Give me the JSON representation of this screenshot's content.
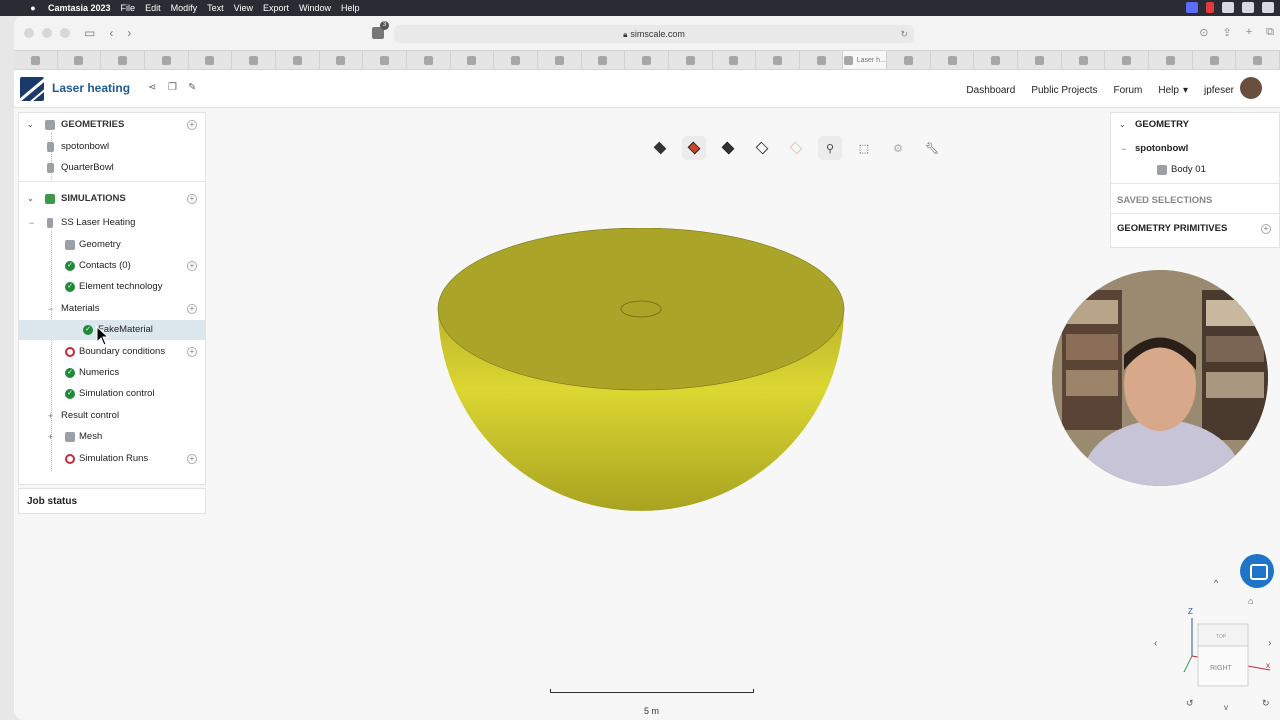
{
  "menubar": {
    "app_name": "Camtasia 2023",
    "items": [
      "File",
      "Edit",
      "Modify",
      "Text",
      "View",
      "Export",
      "Window",
      "Help"
    ]
  },
  "browser": {
    "url": "simscale.com",
    "tab_count_badge": "3",
    "active_tab_label": "Laser h..."
  },
  "header": {
    "project_title": "Laser heating",
    "nav": [
      "Dashboard",
      "Public Projects",
      "Forum",
      "Help"
    ],
    "username": "jpfeser"
  },
  "tree": {
    "geometries": {
      "label": "GEOMETRIES",
      "items": [
        "spotonbowl",
        "QuarterBowl"
      ]
    },
    "simulations": {
      "label": "SIMULATIONS",
      "sim_name": "SS Laser Heating",
      "children": {
        "geometry": "Geometry",
        "contacts": "Contacts (0)",
        "element_technology": "Element technology",
        "materials": "Materials",
        "material_item": "FakeMaterial",
        "boundary_conditions": "Boundary conditions",
        "numerics": "Numerics",
        "simulation_control": "Simulation control",
        "result_control": "Result control",
        "mesh": "Mesh",
        "simulation_runs": "Simulation Runs"
      }
    },
    "job_status": "Job status"
  },
  "right_panel": {
    "geometry_header": "GEOMETRY",
    "geometry_name": "spotonbowl",
    "body": "Body 01",
    "saved_selections": "SAVED SELECTIONS",
    "geometry_primitives": "GEOMETRY PRIMITIVES"
  },
  "viewer": {
    "scale_label": "5 m",
    "axis_label": "Z",
    "cube_top": "TOP",
    "cube_right": "RIGHT",
    "model_color": "#c8c22a"
  }
}
